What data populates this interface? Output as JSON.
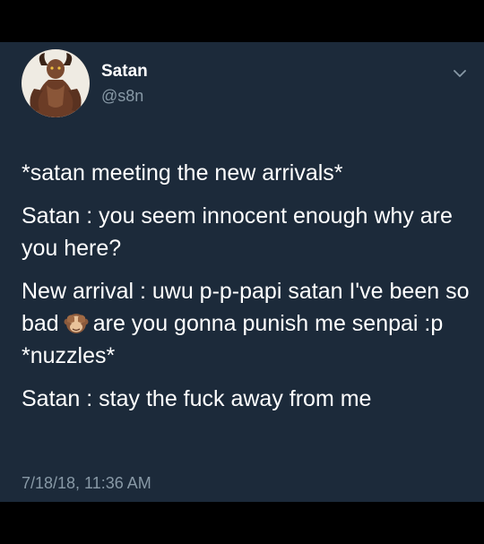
{
  "tweet": {
    "author": {
      "display_name": "Satan",
      "handle": "@s8n",
      "avatar": "demon-avatar"
    },
    "menu_icon": "chevron-down-icon",
    "lines": {
      "p1": "*satan meeting the new arrivals*",
      "p2": "Satan : you seem innocent enough why are you here?",
      "p3_before_emoji": "New arrival : uwu p-p-papi satan I've been so bad",
      "p3_emoji": "see-no-evil-monkey-icon",
      "p3_after_emoji": "are you gonna punish me senpai :p *nuzzles*",
      "p4": "Satan : stay the fuck away from me"
    },
    "timestamp": "7/18/18, 11:36 AM"
  },
  "colors": {
    "background": "#000000",
    "card": "#1c2a3a",
    "text": "#ffffff",
    "secondary_text": "#8899a6"
  }
}
